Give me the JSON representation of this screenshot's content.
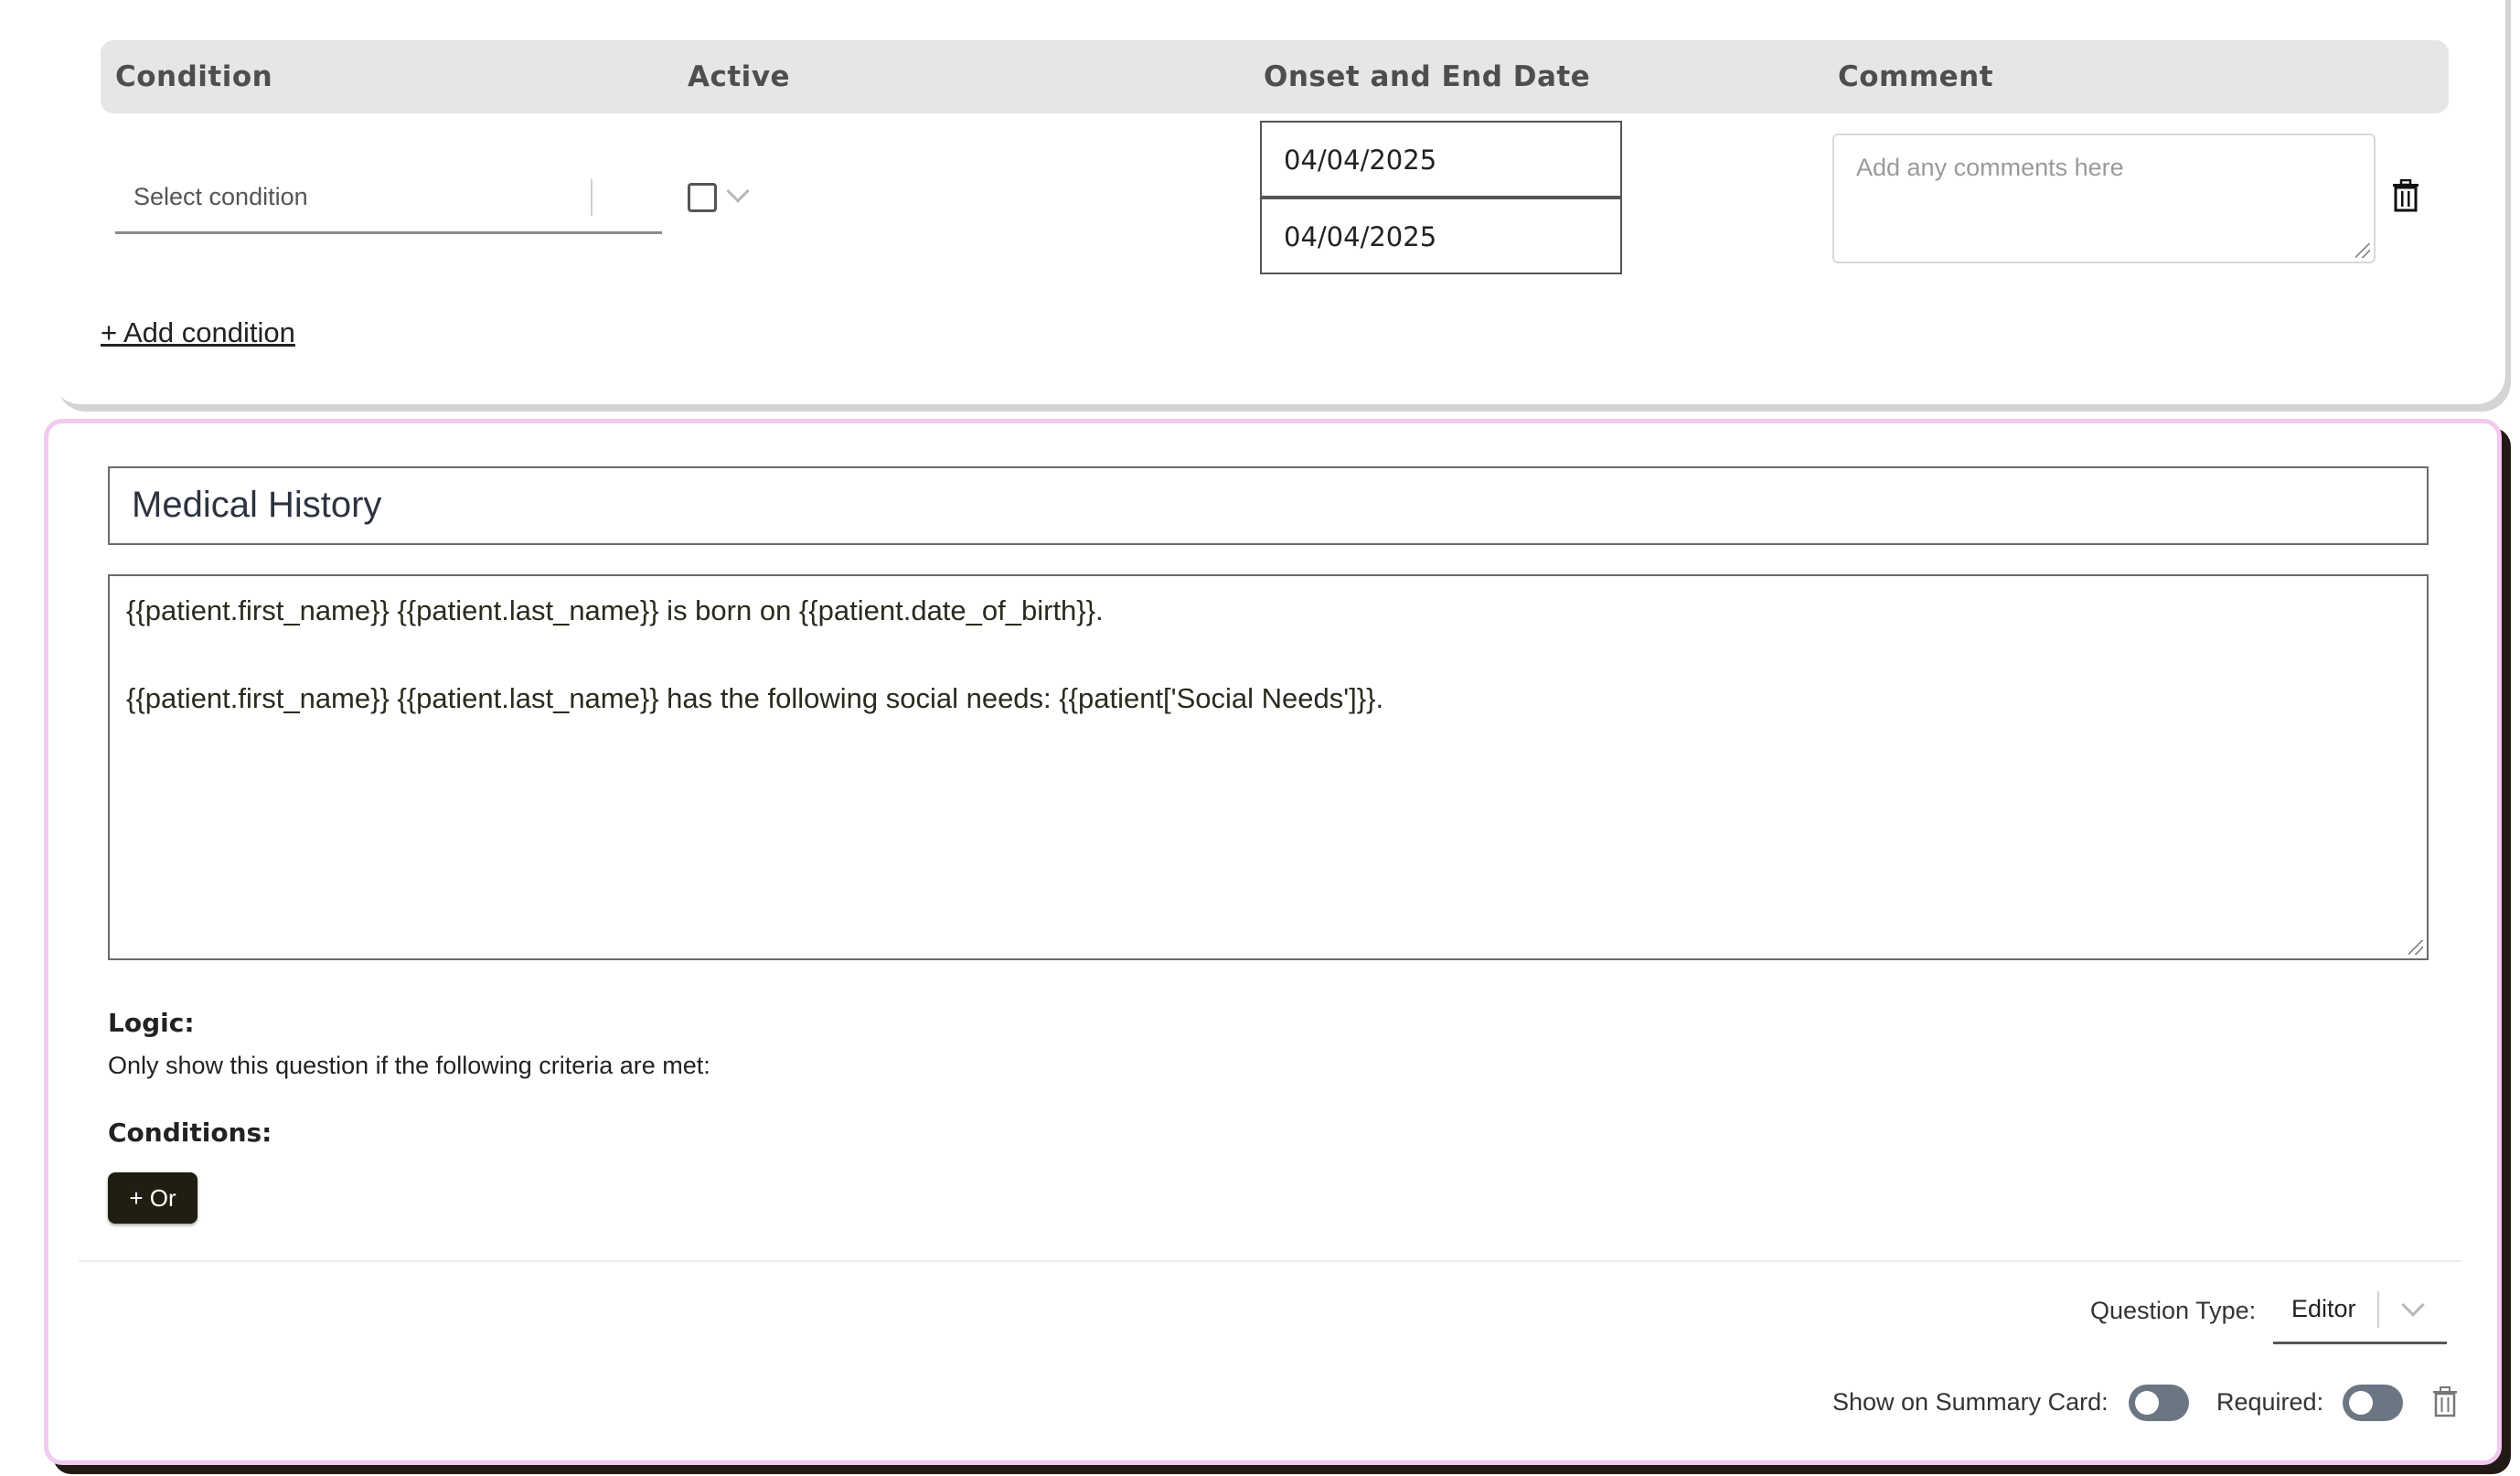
{
  "conditions_table": {
    "headers": {
      "condition": "Condition",
      "active": "Active",
      "onset_end_date": "Onset and End Date",
      "comment": "Comment"
    },
    "row": {
      "condition_placeholder": "Select condition",
      "active": false,
      "onset_date": "04/04/2025",
      "end_date": "04/04/2025",
      "comment_placeholder": "Add any comments here"
    },
    "add_condition_label": "+ Add condition"
  },
  "question": {
    "title": "Medical History",
    "body_lines": [
      "{{patient.first_name}} {{patient.last_name}} is born on {{patient.date_of_birth}}.",
      "{{patient.first_name}} {{patient.last_name}} has the following social needs: {{patient['Social Needs']}}."
    ],
    "logic_label": "Logic:",
    "logic_description": "Only show this question if the following criteria are met:",
    "conditions_label": "Conditions:",
    "or_button_label": "+ Or",
    "question_type_label": "Question Type:",
    "question_type_value": "Editor",
    "show_on_summary_label": "Show on Summary Card:",
    "show_on_summary": false,
    "required_label": "Required:",
    "required": false
  },
  "colors": {
    "accent_border": "#f3c9ef",
    "dark_button": "#201e10",
    "toggle_off": "#6c7683"
  }
}
